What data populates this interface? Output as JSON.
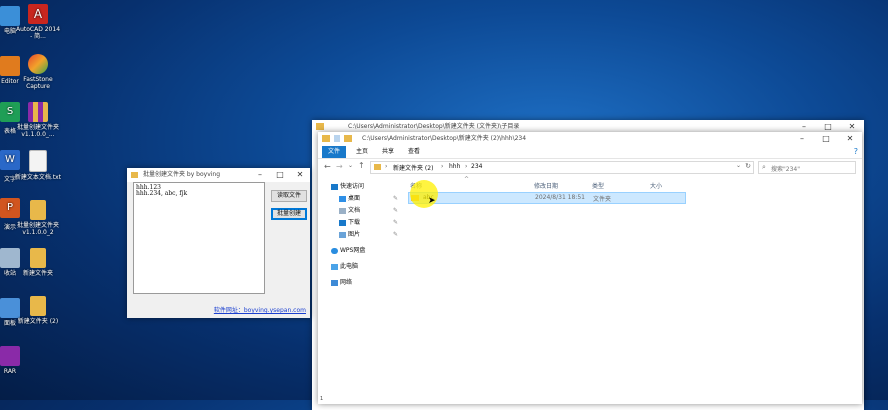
{
  "desktop": {
    "icons": [
      {
        "label": "电脑",
        "color": "#3b8fd8"
      },
      {
        "label": "AutoCAD 2014 - 简...",
        "color": "#c8261f"
      },
      {
        "label": "Editor",
        "color": "#e07b1e"
      },
      {
        "label": "FastStone Capture",
        "color": "#e5452d"
      },
      {
        "label": "S\n表格",
        "color": "#1f9e56"
      },
      {
        "label": "批量创建文件夹v1.1.0.0_...",
        "color": "#8a2aa8"
      },
      {
        "label": "W\n文字",
        "color": "#2a68c8"
      },
      {
        "label": "新建文本文档.txt",
        "color": "#f3f3f3"
      },
      {
        "label": "P\n演示",
        "color": "#d1551f"
      },
      {
        "label": "批量创建文件夹v1.1.0.0_2",
        "color": "#e8b84a"
      },
      {
        "label": "收站",
        "color": "#9fb7cf"
      },
      {
        "label": "新建文件夹",
        "color": "#e8b84a"
      },
      {
        "label": "面板",
        "color": "#4a90d9"
      },
      {
        "label": "新建文件夹 (2)",
        "color": "#e8b84a"
      },
      {
        "label": "RAR",
        "color": "#8a2aa8"
      }
    ]
  },
  "dialog": {
    "title": "批量创建文件夹 by boyving",
    "text": "hhh.123\nhhh.234, abc, fjk",
    "read_button": "读取文件",
    "create_button": "批量创建",
    "link": "软件网址：boyving.ysepan.com"
  },
  "explorer": {
    "title_path": "C:\\Users\\Administrator\\Desktop\\新建文件夹 (文件夹)\\子目录",
    "path_text": "C:\\Users\\Administrator\\Desktop\\新建文件夹 (2)\\hhh\\234",
    "tabs": [
      "文件",
      "主页",
      "共享",
      "查看"
    ],
    "breadcrumb": [
      "新建文件夹 (2)",
      "hhh",
      "234"
    ],
    "search_placeholder": "搜索\"234\"",
    "columns": [
      "名称",
      "修改日期",
      "类型",
      "大小"
    ],
    "nav": [
      {
        "label": "快速访问",
        "pinned": false
      },
      {
        "label": "桌面",
        "pinned": true
      },
      {
        "label": "文档",
        "pinned": true
      },
      {
        "label": "下载",
        "pinned": true
      },
      {
        "label": "图片",
        "pinned": true
      },
      {
        "label": "WPS网盘",
        "pinned": false
      },
      {
        "label": "此电脑",
        "pinned": false
      },
      {
        "label": "网络",
        "pinned": false
      }
    ],
    "files": [
      {
        "name": "abc",
        "modified": "2024/8/31 18:51",
        "type": "文件夹",
        "size": ""
      }
    ],
    "status_count": "1",
    "accent": "#1979ca",
    "selection": "#cce8ff"
  }
}
